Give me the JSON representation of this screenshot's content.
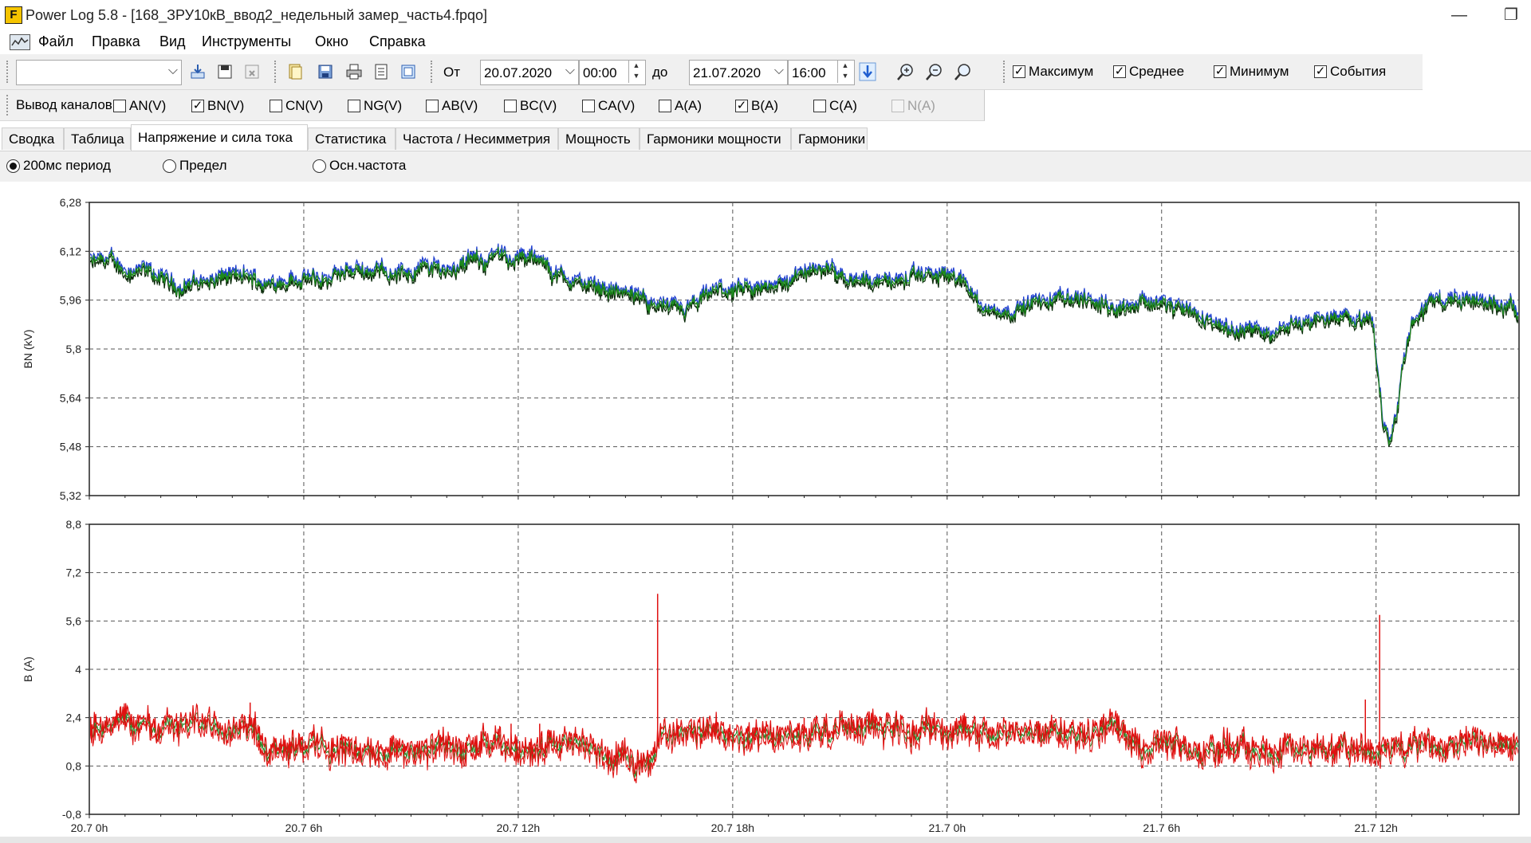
{
  "window": {
    "app_logo": "F",
    "title": "Power Log 5.8 - [168_ЗРУ10кВ_ввод2_недельный замер_часть4.fpqo]",
    "minimize_glyph": "—",
    "restore_glyph": "❐"
  },
  "menu": {
    "items": [
      "Файл",
      "Правка",
      "Вид",
      "Инструменты",
      "Окно",
      "Справка"
    ]
  },
  "toolbar": {
    "template_combo_value": "",
    "from_label": "От",
    "from_date": "20.07.2020",
    "from_time": "00:00",
    "to_label": "до",
    "to_date": "21.07.2020",
    "to_time": "16:00",
    "display_options": [
      {
        "label": "Максимум",
        "checked": true
      },
      {
        "label": "Среднее",
        "checked": true
      },
      {
        "label": "Минимум",
        "checked": true
      },
      {
        "label": "События",
        "checked": true
      }
    ],
    "icons": [
      "import-icon",
      "save-template-icon",
      "delete-template-icon",
      "open-icon",
      "save-icon",
      "print-icon",
      "print-preview-icon",
      "export-icon",
      "apply-range-icon",
      "zoom-in-icon",
      "zoom-out-icon",
      "zoom-fit-icon"
    ]
  },
  "channels": {
    "label": "Вывод каналов",
    "items": [
      {
        "label": "AN(V)",
        "checked": false,
        "disabled": false
      },
      {
        "label": "BN(V)",
        "checked": true,
        "disabled": false
      },
      {
        "label": "CN(V)",
        "checked": false,
        "disabled": false
      },
      {
        "label": "NG(V)",
        "checked": false,
        "disabled": false
      },
      {
        "label": "AB(V)",
        "checked": false,
        "disabled": false
      },
      {
        "label": "BC(V)",
        "checked": false,
        "disabled": false
      },
      {
        "label": "CA(V)",
        "checked": false,
        "disabled": false
      },
      {
        "label": "A(A)",
        "checked": false,
        "disabled": false
      },
      {
        "label": "B(A)",
        "checked": true,
        "disabled": false
      },
      {
        "label": "C(A)",
        "checked": false,
        "disabled": false
      },
      {
        "label": "N(A)",
        "checked": false,
        "disabled": true
      }
    ]
  },
  "tabs": {
    "items": [
      "Сводка",
      "Таблица",
      "Напряжение и сила тока",
      "Статистика",
      "Частота / Несимметрия",
      "Мощность",
      "Гармоники мощности",
      "Гармоники"
    ],
    "active": "Напряжение и сила тока"
  },
  "mode": {
    "items": [
      {
        "label": "200мс период",
        "selected": true
      },
      {
        "label": "Предел",
        "selected": false
      },
      {
        "label": "Осн.частота",
        "selected": false
      }
    ]
  },
  "chart_data": [
    {
      "type": "line",
      "title": "",
      "ylabel": "BN (kV)",
      "xlabel": "",
      "ylim": [
        5.32,
        6.28
      ],
      "yticks": [
        "6,28",
        "6,12",
        "5,96",
        "5,8",
        "5,64",
        "5,48",
        "5,32"
      ],
      "xlim_hours": [
        0,
        40
      ],
      "xticks": [
        "20.7 0h",
        "20.7 6h",
        "20.7 12h",
        "20.7 18h",
        "21.7 0h",
        "21.7 6h",
        "21.7 12h"
      ],
      "grid": true,
      "colors": {
        "max": "#1f3fd0",
        "avg": "#1d8a1d",
        "min": "#0a2a0a"
      },
      "series": [
        {
          "values_per_hour": [
            [
              0,
              6.08
            ],
            [
              0.5,
              6.09
            ],
            [
              1,
              6.06
            ],
            [
              1.5,
              6.05
            ],
            [
              2,
              6.03
            ],
            [
              2.5,
              6.0
            ],
            [
              3,
              6.02
            ],
            [
              3.5,
              6.02
            ],
            [
              4,
              6.04
            ],
            [
              4.5,
              6.03
            ],
            [
              5,
              6.01
            ],
            [
              5.5,
              6.03
            ],
            [
              6,
              6.03
            ],
            [
              6.5,
              6.02
            ],
            [
              7,
              6.04
            ],
            [
              7.5,
              6.06
            ],
            [
              8,
              6.06
            ],
            [
              8.5,
              6.05
            ],
            [
              9,
              6.05
            ],
            [
              9.5,
              6.07
            ],
            [
              10,
              6.06
            ],
            [
              10.5,
              6.08
            ],
            [
              11,
              6.09
            ],
            [
              11.5,
              6.1
            ],
            [
              12,
              6.1
            ],
            [
              12.5,
              6.09
            ],
            [
              13,
              6.05
            ],
            [
              13.5,
              6.02
            ],
            [
              14,
              6.01
            ],
            [
              14.5,
              6.0
            ],
            [
              15,
              5.98
            ],
            [
              15.5,
              5.96
            ],
            [
              16,
              5.94
            ],
            [
              16.5,
              5.92
            ],
            [
              17,
              5.94
            ],
            [
              17.5,
              5.99
            ],
            [
              18,
              5.99
            ],
            [
              18.5,
              5.98
            ],
            [
              19,
              6.01
            ],
            [
              19.5,
              6.02
            ],
            [
              20,
              6.04
            ],
            [
              20.5,
              6.07
            ],
            [
              21,
              6.05
            ],
            [
              21.5,
              6.03
            ],
            [
              22,
              6.03
            ],
            [
              22.5,
              6.02
            ],
            [
              23,
              6.03
            ],
            [
              23.5,
              6.04
            ],
            [
              24,
              6.04
            ],
            [
              24.5,
              6.02
            ],
            [
              25,
              5.93
            ],
            [
              25.5,
              5.92
            ],
            [
              26,
              5.93
            ],
            [
              26.5,
              5.95
            ],
            [
              27,
              5.96
            ],
            [
              27.5,
              5.97
            ],
            [
              28,
              5.96
            ],
            [
              28.5,
              5.94
            ],
            [
              29,
              5.94
            ],
            [
              29.5,
              5.96
            ],
            [
              30,
              5.95
            ],
            [
              30.5,
              5.93
            ],
            [
              31,
              5.9
            ],
            [
              31.5,
              5.89
            ],
            [
              32,
              5.87
            ],
            [
              32.5,
              5.86
            ],
            [
              33,
              5.85
            ],
            [
              33.5,
              5.88
            ],
            [
              34,
              5.89
            ],
            [
              34.5,
              5.9
            ],
            [
              35,
              5.9
            ],
            [
              35.5,
              5.91
            ],
            [
              35.9,
              5.88
            ],
            [
              36.2,
              5.56
            ],
            [
              36.4,
              5.5
            ],
            [
              36.6,
              5.62
            ],
            [
              36.8,
              5.8
            ],
            [
              37,
              5.9
            ],
            [
              37.5,
              5.95
            ],
            [
              38,
              5.96
            ],
            [
              39,
              5.95
            ],
            [
              40,
              5.94
            ]
          ]
        }
      ]
    },
    {
      "type": "line",
      "title": "",
      "ylabel": "B (A)",
      "xlabel": "",
      "ylim": [
        -0.8,
        8.8
      ],
      "yticks": [
        "8,8",
        "7,2",
        "5,6",
        "4",
        "2,4",
        "0,8",
        "-0,8"
      ],
      "xlim_hours": [
        0,
        40
      ],
      "xticks": [
        "20.7 0h",
        "20.7 6h",
        "20.7 12h",
        "20.7 18h",
        "21.7 0h",
        "21.7 6h",
        "21.7 12h"
      ],
      "grid": true,
      "colors": {
        "max": "#e01010",
        "avg": "#2a8a2a",
        "min": "#e01010"
      },
      "series": [
        {
          "values_per_hour": [
            [
              0,
              2.0
            ],
            [
              1,
              2.1
            ],
            [
              2,
              2.1
            ],
            [
              3,
              2.2
            ],
            [
              4,
              2.2
            ],
            [
              4.6,
              2.1
            ],
            [
              4.8,
              1.6
            ],
            [
              5,
              1.5
            ],
            [
              6,
              1.5
            ],
            [
              7,
              1.4
            ],
            [
              8,
              1.3
            ],
            [
              9,
              1.3
            ],
            [
              10,
              1.4
            ],
            [
              11,
              1.4
            ],
            [
              12,
              1.4
            ],
            [
              13,
              1.4
            ],
            [
              14,
              1.5
            ],
            [
              14.3,
              1.1
            ],
            [
              15,
              1.0
            ],
            [
              15.8,
              1.0
            ],
            [
              16,
              1.9
            ],
            [
              17,
              2.0
            ],
            [
              18,
              1.9
            ],
            [
              19,
              1.8
            ],
            [
              20,
              1.8
            ],
            [
              21,
              2.1
            ],
            [
              22,
              2.1
            ],
            [
              23,
              2.0
            ],
            [
              24,
              2.0
            ],
            [
              25,
              1.9
            ],
            [
              26,
              1.9
            ],
            [
              27,
              2.0
            ],
            [
              28,
              2.0
            ],
            [
              28.9,
              2.1
            ],
            [
              29.1,
              1.5
            ],
            [
              30,
              1.5
            ],
            [
              31,
              1.4
            ],
            [
              32,
              1.4
            ],
            [
              33,
              1.3
            ],
            [
              34,
              1.3
            ],
            [
              35,
              1.3
            ],
            [
              36,
              1.3
            ],
            [
              37,
              1.4
            ],
            [
              38,
              1.5
            ],
            [
              39,
              1.5
            ],
            [
              40,
              1.5
            ]
          ],
          "spikes": [
            [
              15.9,
              6.5
            ],
            [
              20,
              2.4
            ],
            [
              35.7,
              3.0
            ],
            [
              36.1,
              5.8
            ],
            [
              4.5,
              2.9
            ],
            [
              11.8,
              2.2
            ],
            [
              12.6,
              2.2
            ]
          ]
        }
      ]
    }
  ]
}
